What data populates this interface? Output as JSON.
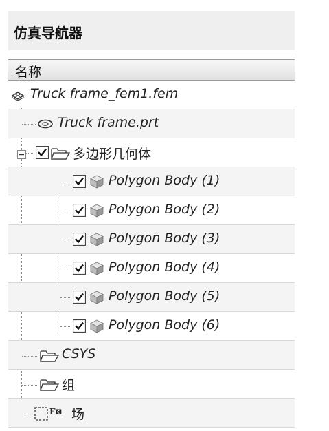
{
  "panel": {
    "title": "仿真导航器",
    "column_header": "名称"
  },
  "tree": {
    "root_label": "Truck frame_fem1.fem",
    "part_label": "Truck frame.prt",
    "group_label": "多边形几何体",
    "bodies": [
      "Polygon Body (1)",
      "Polygon Body (2)",
      "Polygon Body (3)",
      "Polygon Body (4)",
      "Polygon Body (5)",
      "Polygon Body (6)"
    ],
    "csys_label": "CSYS",
    "groups_folder_label": "组",
    "field_label": "场",
    "field_icon_text": "F⊠"
  },
  "icons": {
    "root": "fem-mesh-icon",
    "part": "part-link-icon",
    "expand": "collapse-minus-icon",
    "checkbox": "checkbox-checked-icon",
    "folder": "folder-open-icon",
    "body": "polygon-body-cube-icon",
    "field": "field-icon"
  }
}
